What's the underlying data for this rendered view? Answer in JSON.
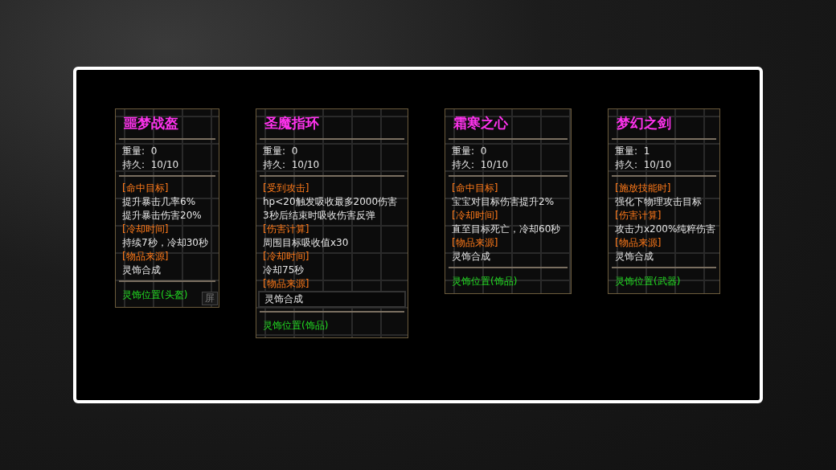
{
  "cards": [
    {
      "title": "噩梦战盔",
      "stats": [
        {
          "label": "重量:",
          "value": "0"
        },
        {
          "label": "持久:",
          "value": "10/10"
        }
      ],
      "lines": [
        {
          "kind": "header",
          "text": "[命中目标]"
        },
        {
          "kind": "text",
          "text": "提升暴击几率6%"
        },
        {
          "kind": "text",
          "text": "提升暴击伤害20%"
        },
        {
          "kind": "header",
          "text": "[冷却时间]"
        },
        {
          "kind": "text",
          "text": "持续7秒，冷却30秒"
        },
        {
          "kind": "header",
          "text": "[物品来源]"
        },
        {
          "kind": "text",
          "text": "灵饰合成"
        }
      ],
      "footer": "灵饰位置(头盔)",
      "side_tab": "屏"
    },
    {
      "title": "圣魔指环",
      "stats": [
        {
          "label": "重量:",
          "value": "0"
        },
        {
          "label": "持久:",
          "value": "10/10"
        }
      ],
      "lines": [
        {
          "kind": "header",
          "text": "[受到攻击]"
        },
        {
          "kind": "text",
          "text": "hp<20触发吸收最多2000伤害"
        },
        {
          "kind": "text",
          "text": "3秒后结束时吸收伤害反弹"
        },
        {
          "kind": "header",
          "text": "[伤害计算]"
        },
        {
          "kind": "text",
          "text": "周围目标吸收值x30"
        },
        {
          "kind": "header",
          "text": "[冷却时间]"
        },
        {
          "kind": "text",
          "text": "冷却75秒"
        },
        {
          "kind": "header",
          "text": "[物品来源]"
        },
        {
          "kind": "boxed",
          "text": "灵饰合成"
        }
      ],
      "footer": "灵饰位置(饰品)"
    },
    {
      "title": "霜寒之心",
      "stats": [
        {
          "label": "重量:",
          "value": "0"
        },
        {
          "label": "持久:",
          "value": "10/10"
        }
      ],
      "lines": [
        {
          "kind": "header",
          "text": "[命中目标]"
        },
        {
          "kind": "text",
          "text": "宝宝对目标伤害提升2%"
        },
        {
          "kind": "header",
          "text": "[冷却时间]"
        },
        {
          "kind": "text",
          "text": "直至目标死亡，冷却60秒"
        },
        {
          "kind": "header",
          "text": "[物品来源]"
        },
        {
          "kind": "text",
          "text": "灵饰合成"
        }
      ],
      "footer": "灵饰位置(饰品)"
    },
    {
      "title": "梦幻之剑",
      "stats": [
        {
          "label": "重量:",
          "value": "1"
        },
        {
          "label": "持久:",
          "value": "10/10"
        }
      ],
      "lines": [
        {
          "kind": "header",
          "text": "[施放技能时]"
        },
        {
          "kind": "text",
          "text": "强化下物理攻击目标"
        },
        {
          "kind": "header",
          "text": "[伤害计算]"
        },
        {
          "kind": "text",
          "text": "攻击力x200%纯粹伤害"
        },
        {
          "kind": "header",
          "text": "[物品来源]"
        },
        {
          "kind": "text",
          "text": "灵饰合成"
        }
      ],
      "footer": "灵饰位置(武器)"
    }
  ]
}
